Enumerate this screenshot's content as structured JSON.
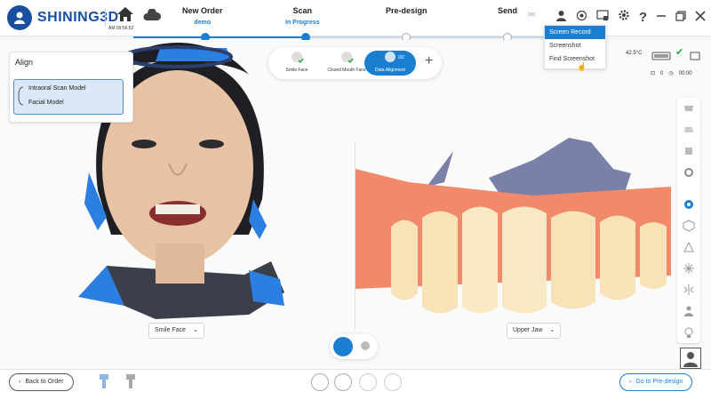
{
  "brand": {
    "name": "SHINING3D",
    "color": "#1a4fa0"
  },
  "header": {
    "time": "AM 09:56:52",
    "tiny_tag": "000",
    "steps": [
      {
        "label": "New Order",
        "sub": "demo"
      },
      {
        "label": "Scan",
        "sub": "In Progress"
      },
      {
        "label": "Pre-design",
        "sub": ""
      },
      {
        "label": "Send",
        "sub": ""
      }
    ]
  },
  "dropdown": {
    "items": [
      "Screen Record",
      "Screenshot",
      "Find Screenshot"
    ],
    "active_index": 0
  },
  "align_panel": {
    "title": "Align",
    "items": [
      "Intraoral Scan Model",
      "Facial Model"
    ]
  },
  "tabs": [
    {
      "label": "Smile Face",
      "sub": ""
    },
    {
      "label": "Closed Mouth Face",
      "sub": ""
    },
    {
      "label": "Data Alignment",
      "sub": "0/2"
    }
  ],
  "status": {
    "temperature": "42.5°C",
    "count_a": "0",
    "count_b": "00:00"
  },
  "selectors": {
    "left": "Smile Face",
    "right": "Upper Jaw"
  },
  "footer": {
    "back_label": "Back to Order",
    "next_label": "Go to Pre-design"
  },
  "colors": {
    "accent": "#1a7fd1",
    "scan_blue": "#2a7fe0",
    "gum": "#f08a6a",
    "tooth": "#f8e2b8",
    "bite": "#7a80a8"
  }
}
